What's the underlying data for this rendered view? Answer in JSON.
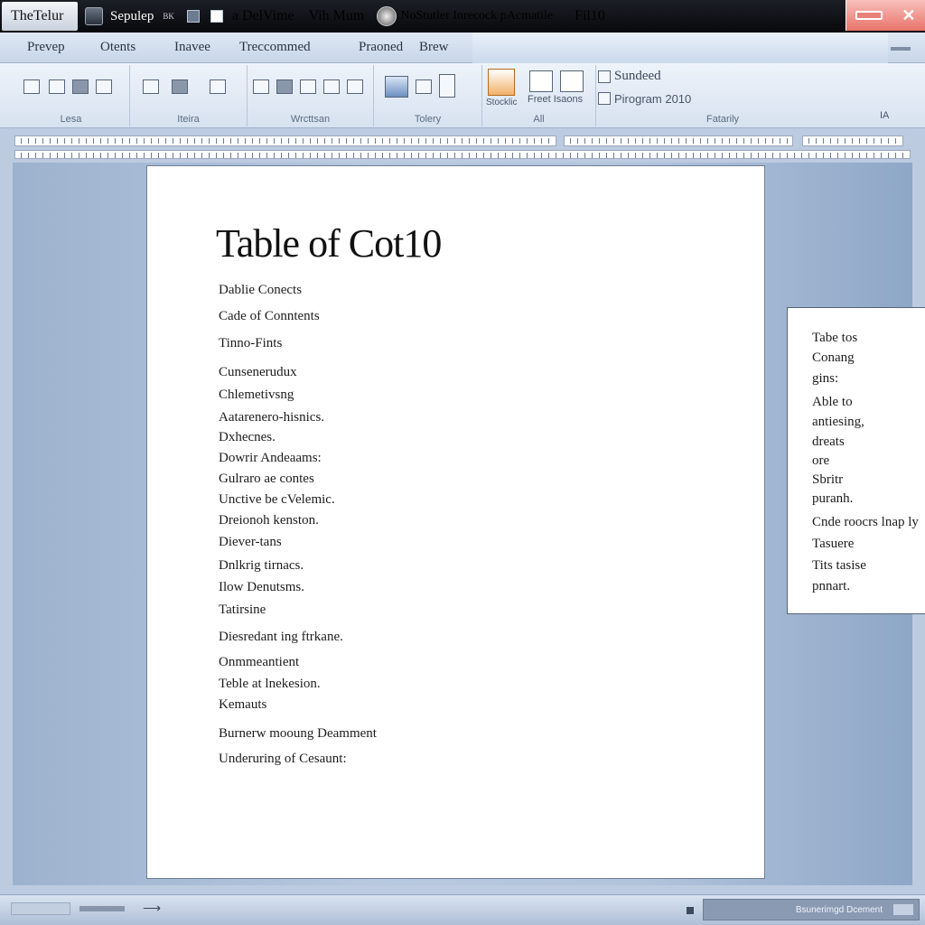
{
  "titlebar": {
    "app_title": "TheTelur",
    "doc_name": "Sepulep",
    "small_label": "BK",
    "segment1": "a DelVime",
    "segment2": "Vih Mum",
    "segment3": "NoStutler Inrecock pAcmatile",
    "segment4": "Fil10"
  },
  "menu": {
    "items": [
      "Prevep",
      "Otents",
      "Inavee",
      "Treccommed",
      "Praoned",
      "Brew"
    ]
  },
  "ribbon": {
    "group_labels": [
      "Lesa",
      "Iteira",
      "Wrcttsan",
      "Tolery",
      "All",
      "Fatarily",
      "IA"
    ],
    "style_small_label": "Stocklic",
    "frees_label": "Freet Isaons",
    "standard_label": "Sundeed",
    "program_label": "Pirogram 2010"
  },
  "document": {
    "title": "Table of Cot10",
    "lines": [
      "Dablie Conects",
      "Cade of Conntents",
      "Tinno-Fints",
      "Cunsenerudux",
      "Chlemetivsng",
      "Aatarenero-hisnics.",
      "Dxhecnes.",
      "Dowrir Andeaams:",
      "Gulraro ae contes",
      "Unctive be cVelemic.",
      "Dreionoh kenston.",
      "Diever-tans",
      "Dnlkrig tirnacs.",
      "Ilow Denutsms.",
      "Tatirsine",
      "Diesredant ing ftrkane.",
      "Onmmeantient",
      "Teble at lnekesion.",
      "Kemauts",
      "Burnerw mooung Deamment",
      "Underuring of Cesaunt:"
    ]
  },
  "sidepanel": {
    "lines": [
      "Tabe tos",
      "Conang",
      "gins:",
      "Able to",
      "antiesing,",
      "dreats",
      "ore",
      "Sbritr",
      "puranh.",
      "Cnde roocrs lnap ly",
      "Tasuere",
      "Tits tasise",
      "pnnart."
    ]
  },
  "statusbar": {
    "right_text": "Bsunerimgd Dcement"
  },
  "colors": {
    "titlebar_bg": "#0b0d11",
    "close_button": "#e9736a",
    "workspace_bg": "#b2c4dc",
    "page_bg": "#ffffff"
  }
}
